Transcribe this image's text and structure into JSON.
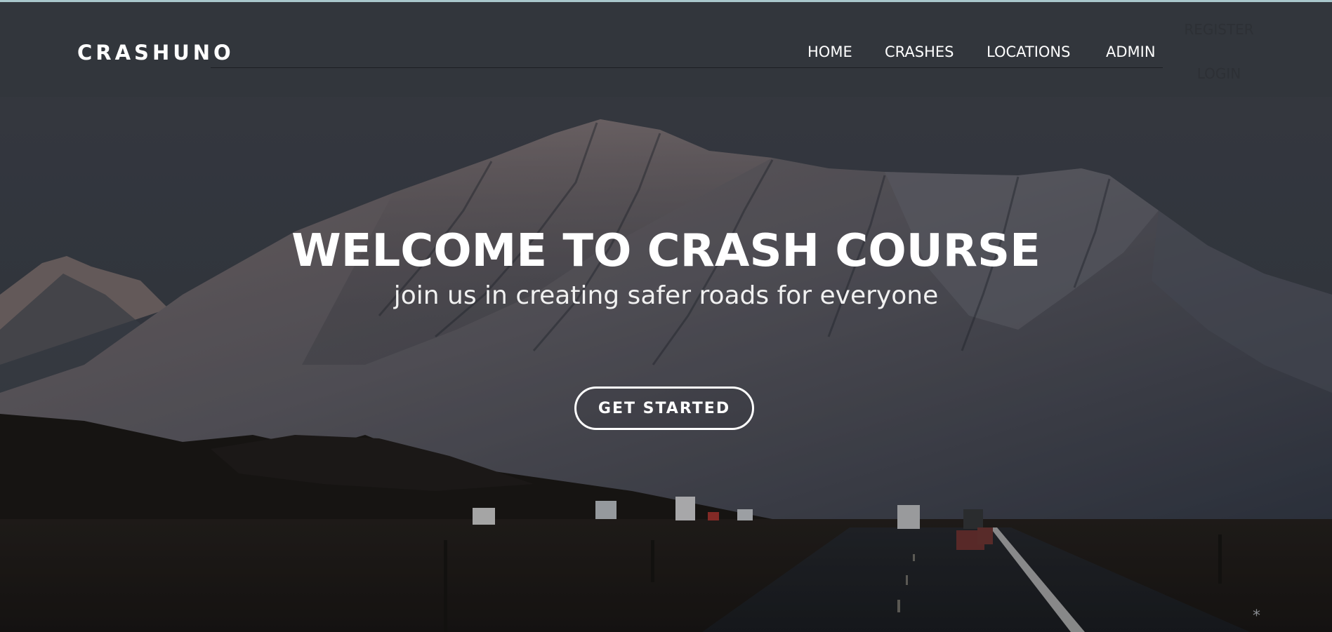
{
  "navbar": {
    "brand": "CRASHUNO",
    "links": [
      {
        "label": "HOME"
      },
      {
        "label": "CRASHES"
      },
      {
        "label": "LOCATIONS"
      },
      {
        "label": "ADMIN"
      }
    ],
    "auth": {
      "register": "REGISTER",
      "login": "LOGIN"
    }
  },
  "hero": {
    "title": "WELCOME TO CRASH COURSE",
    "subtitle": "join us in creating safer roads for everyone",
    "cta_label": "GET STARTED",
    "background": "mountain-highway-photo"
  },
  "footer_glyph": "*",
  "colors": {
    "navbar_bg": "#32363c",
    "top_line": "#a9c7cc",
    "text": "#ffffff",
    "auth_text": "#2d3035"
  }
}
